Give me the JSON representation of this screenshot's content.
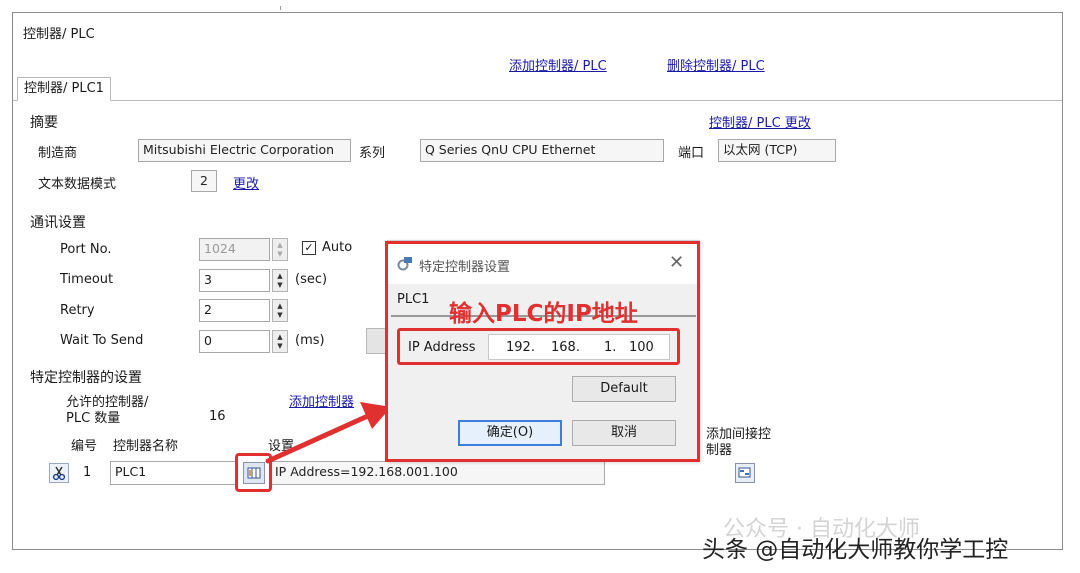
{
  "header": {
    "title": "控制器/ PLC",
    "add_link": "添加控制器/ PLC",
    "delete_link": "删除控制器/ PLC"
  },
  "tabs": [
    {
      "label": "控制器/ PLC1",
      "active": true
    }
  ],
  "summary": {
    "heading": "摘要",
    "change_link": "控制器/ PLC 更改",
    "manufacturer_label": "制造商",
    "manufacturer_value": "Mitsubishi Electric Corporation",
    "series_label": "系列",
    "series_value": "Q Series QnU CPU Ethernet",
    "port_label": "端口",
    "port_value": "以太网 (TCP)",
    "text_mode_label": "文本数据模式",
    "text_mode_value": "2",
    "text_mode_change": "更改"
  },
  "comm": {
    "heading": "通讯设置",
    "port_no_label": "Port No.",
    "port_no_value": "1024",
    "auto_label": "Auto",
    "auto_checked": true,
    "timeout_label": "Timeout",
    "timeout_value": "3",
    "timeout_unit": "(sec)",
    "retry_label": "Retry",
    "retry_value": "2",
    "wait_label": "Wait To Send",
    "wait_value": "0",
    "wait_unit": "(ms)"
  },
  "specific": {
    "heading": "特定控制器的设置",
    "allowed_label_1": "允许的控制器/",
    "allowed_label_2": "PLC 数量",
    "allowed_value": "16",
    "add_controller_link": "添加控制器",
    "col_number": "编号",
    "col_name": "控制器名称",
    "col_settings": "设置",
    "add_indirect_1": "添加间接控",
    "add_indirect_2": "制器",
    "row": {
      "number": "1",
      "name": "PLC1",
      "settings": "IP Address=192.168.001.100"
    }
  },
  "dialog": {
    "title": "特定控制器设置",
    "plc_name": "PLC1",
    "annotation": "输入PLC的IP地址",
    "ip_label": "IP Address",
    "ip_octets": [
      "192.",
      "168.",
      "1.",
      "100"
    ],
    "default_button": "Default",
    "ok_button": "确定(O)",
    "cancel_button": "取消"
  },
  "watermark": {
    "faint": "公众号 · 自动化大师",
    "main": "头条 @自动化大师教你学工控"
  },
  "colors": {
    "annotation_red": "#e03030",
    "link_blue": "#1a1aa8",
    "panel_border": "#8c8c8c"
  }
}
